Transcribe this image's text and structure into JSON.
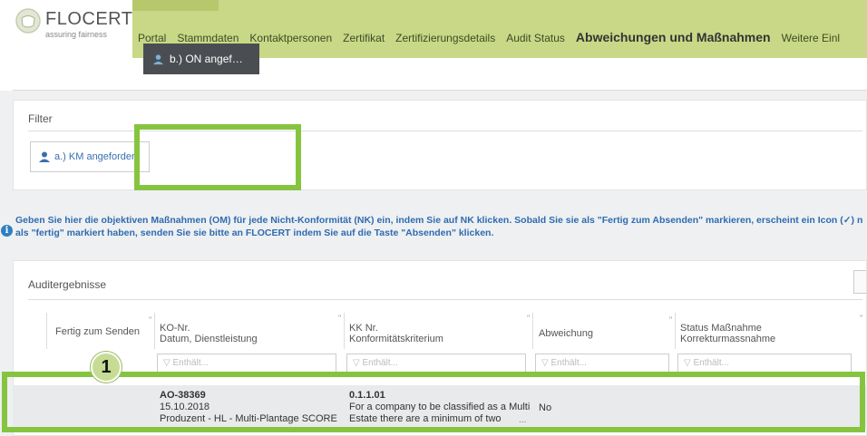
{
  "header": {
    "logo_text": "FLOCERT",
    "logo_sub": "assuring fairness",
    "nav": [
      {
        "label": "Portal"
      },
      {
        "label": "Stammdaten"
      },
      {
        "label": "Kontaktpersonen"
      },
      {
        "label": "Zertifikat"
      },
      {
        "label": "Zertifizierungsdetails"
      },
      {
        "label": "Audit Status"
      },
      {
        "label": "Abweichungen und Maßnahmen",
        "active": true
      },
      {
        "label": "Weitere Einl"
      }
    ]
  },
  "filter": {
    "title": "Filter",
    "button_a": "a.) KM angefordert",
    "button_b": "b.) ON angef…"
  },
  "info": {
    "line1": "Geben Sie hier die objektiven Maßnahmen (OM) für jede Nicht-Konformität (NK) ein, indem Sie auf NK klicken. Sobald Sie sie als \"Fertig zum Absenden\" markieren, erscheint ein Icon (✓) n",
    "line2": "als \"fertig\" markiert haben, senden Sie sie bitte an FLOCERT indem Sie auf die Taste \"Absenden\" klicken."
  },
  "results": {
    "title": "Auditergebnisse",
    "columns": {
      "ready": "Fertig zum Senden",
      "ko_line1": "KO-Nr.",
      "ko_line2": "Datum, Dienstleistung",
      "kk_line1": "KK Nr.",
      "kk_line2": "Konformitätskriterium",
      "deviation": "Abweichung",
      "status_line1": "Status Maßnahme",
      "status_line2": "Korrekturmassnahme"
    },
    "filter_placeholder": "Enthält...",
    "row": {
      "ko_nr": "AO-38369",
      "date": "15.10.2018",
      "service": "Produzent - HL - Multi-Plantage SCORE",
      "kk_nr": "0.1.1.01",
      "criterion_line1": "For a company to be classified as a Multi",
      "criterion_line2": "Estate there are a minimum of two",
      "deviation": "No",
      "ellipsis": "..."
    }
  },
  "annotation": {
    "step_number": "1",
    "highlight_color": "#86c440"
  }
}
